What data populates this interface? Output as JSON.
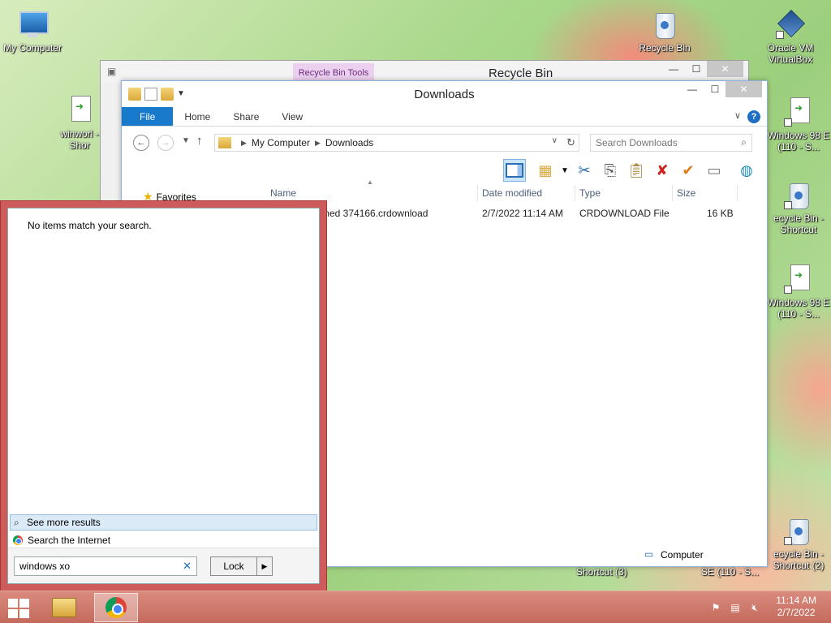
{
  "desktop": {
    "icons": [
      {
        "label": "My Computer",
        "icon": "computer-icon"
      },
      {
        "label": "Recycle Bin",
        "icon": "recycle-bin-icon"
      },
      {
        "label": "Oracle VM VirtualBox",
        "icon": "virtualbox-icon"
      },
      {
        "label": "winworl - Shor",
        "icon": "document-icon"
      },
      {
        "label": "Windows 98 E (110 - S...",
        "icon": "shortcut-doc-icon"
      },
      {
        "label": "ecycle Bin - Shortcut",
        "icon": "recycle-bin-icon"
      },
      {
        "label": "Windows 98 E (110 - S...",
        "icon": "shortcut-doc-icon"
      },
      {
        "label": "ecycle Bin - Shortcut (2)",
        "icon": "recycle-bin-icon"
      }
    ],
    "bottom_labels": [
      "Shortcut (3)",
      "SE (110 - S..."
    ]
  },
  "back_window": {
    "title": "Recycle Bin",
    "context_tab": "Recycle Bin Tools"
  },
  "window": {
    "title": "Downloads",
    "ribbon_tabs": [
      "File",
      "Home",
      "Share",
      "View"
    ],
    "breadcrumb": [
      "My Computer",
      "Downloads"
    ],
    "search_placeholder": "Search Downloads",
    "nav_pane": {
      "favorites": "Favorites"
    },
    "columns": {
      "name": "Name",
      "date": "Date modified",
      "type": "Type",
      "size": "Size"
    },
    "files": [
      {
        "name": "med 374166.crdownload",
        "date": "2/7/2022 11:14 AM",
        "type": "CRDOWNLOAD File",
        "size": "16 KB"
      }
    ],
    "status_location": "Computer"
  },
  "search_popup": {
    "no_items": "No items match your search.",
    "see_more": "See more results",
    "search_internet": "Search the Internet",
    "query": "windows xo",
    "lock_label": "Lock"
  },
  "taskbar": {
    "time": "11:14 AM",
    "date": "2/7/2022"
  },
  "colors": {
    "accent": "#1979ca",
    "popup_border": "#cd5b5b",
    "taskbar": "#c46a5c"
  }
}
